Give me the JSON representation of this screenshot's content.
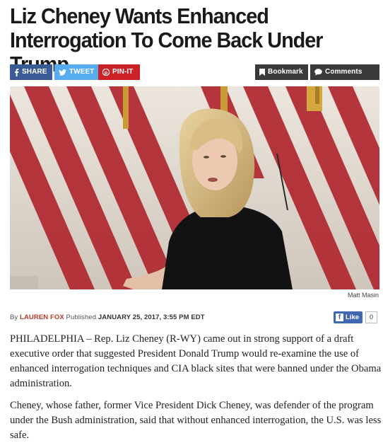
{
  "article": {
    "title": "Liz Cheney Wants Enhanced Interrogation To Come Back Under Trump",
    "share": {
      "facebook_label": "SHARE",
      "twitter_label": "TWEET",
      "pinterest_label": "PIN-IT",
      "bookmark_label": "Bookmark",
      "comments_label": "Comments"
    },
    "photo_credit": "Matt Masin",
    "byline": {
      "prefix": "By",
      "author": "LAUREN FOX",
      "published_label": "Published",
      "date": "JANUARY 25, 2017, 3:55 PM EDT"
    },
    "like": {
      "label": "Like",
      "count": "0"
    },
    "paragraphs": [
      "PHILADELPHIA – Rep. Liz Cheney (R-WY) came out in strong support of a draft executive order that suggested President Donald Trump would re-examine the use of enhanced interrogation techniques and CIA black sites that were banned under the Obama administration.",
      "Cheney, whose father, former Vice President Dick Cheney, was defender of the program under the Bush administration, said that without enhanced interrogation, the U.S. was less safe."
    ]
  },
  "colors": {
    "facebook": "#3b5b98",
    "twitter": "#55acee",
    "pinterest": "#cc2127",
    "dark_button": "#3a3a3a",
    "author": "#c0392b"
  },
  "icons": [
    "facebook-icon",
    "twitter-icon",
    "pinterest-icon",
    "bookmark-icon",
    "comment-icon"
  ]
}
